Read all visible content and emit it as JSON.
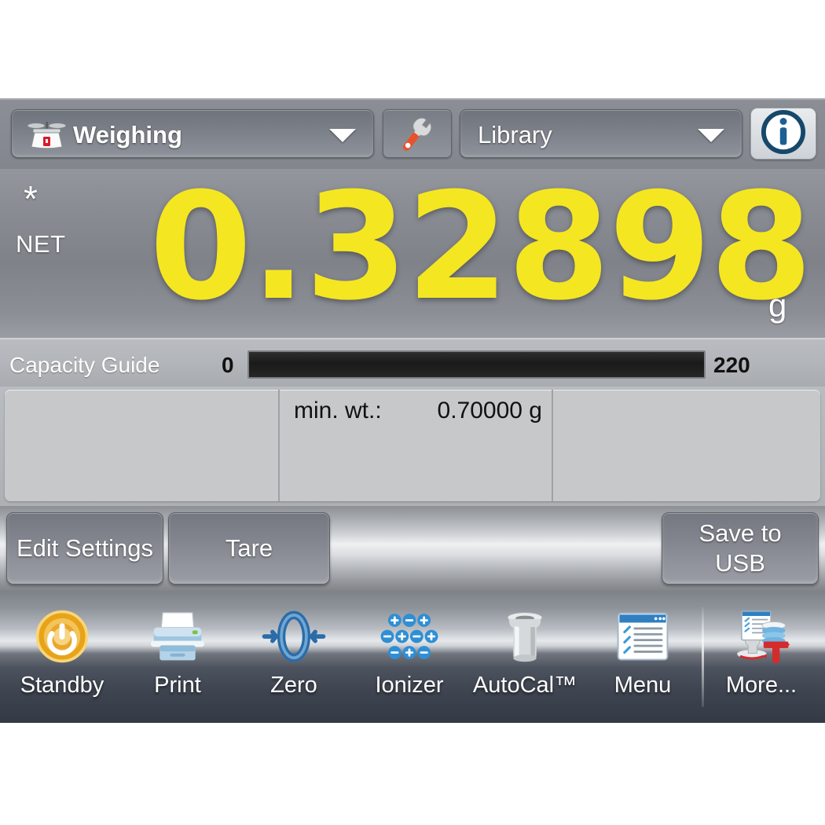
{
  "device": {
    "name": "balance-touchscreen-display"
  },
  "topbar": {
    "mode_select": {
      "label": "Weighing",
      "icon": "balance-scale-icon",
      "caret": "chevron-down-icon"
    },
    "tools_button": {
      "icon": "wrench-icon"
    },
    "library_select": {
      "label": "Library",
      "caret": "chevron-down-icon"
    },
    "info_button": {
      "icon": "info-icon",
      "glyph": "i"
    }
  },
  "weight": {
    "star_indicator": "*",
    "net_indicator": "NET",
    "value": "0.32898",
    "unit": "g",
    "color": "#f5e622"
  },
  "capacity": {
    "label": "Capacity Guide",
    "min": "0",
    "max": "220",
    "fill_percent": 0
  },
  "panels": [
    {
      "key": "",
      "value": ""
    },
    {
      "key": "min. wt.:",
      "value": "0.70000 g"
    },
    {
      "key": "",
      "value": ""
    }
  ],
  "actions": {
    "edit_settings": "Edit Settings",
    "tare": "Tare",
    "save_to_usb": "Save to\nUSB",
    "save_to_usb_line1": "Save to",
    "save_to_usb_line2": "USB"
  },
  "iconbar": [
    {
      "label": "Standby",
      "icon": "power-standby-icon"
    },
    {
      "label": "Print",
      "icon": "printer-icon"
    },
    {
      "label": "Zero",
      "icon": "zero-arrows-icon"
    },
    {
      "label": "Ionizer",
      "icon": "ionizer-charges-icon"
    },
    {
      "label": "AutoCal™",
      "icon": "calibration-weight-icon"
    },
    {
      "label": "Menu",
      "icon": "menu-window-icon"
    },
    {
      "label": "More...",
      "icon": "more-documents-icon"
    }
  ],
  "colors": {
    "weight_yellow": "#f5e622",
    "panel_gray": "#c6c8ca",
    "chrome_gray": "#8b8e95",
    "iconbar_dark": "#333945"
  }
}
